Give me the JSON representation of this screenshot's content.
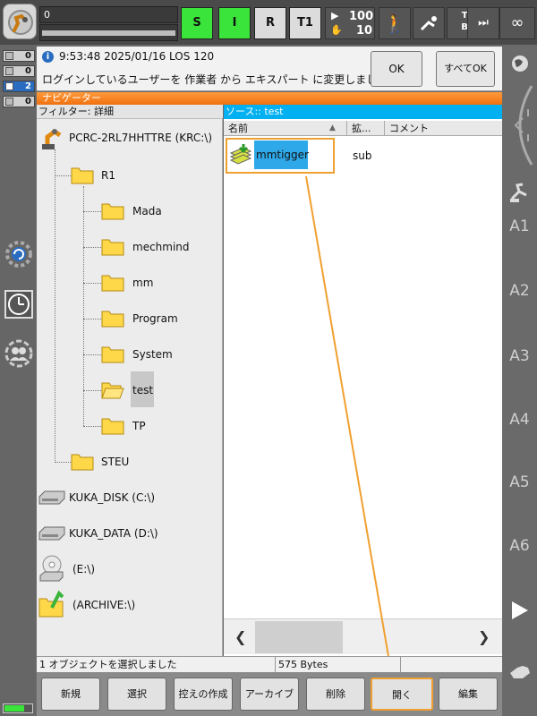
{
  "topbar": {
    "program_line": "0",
    "btn_s": "S",
    "btn_i": "I",
    "btn_r": "R",
    "mode": "T1",
    "override_prog": "100",
    "override_jog": "10",
    "tool_base_t": "T?",
    "tool_base_b": "B?",
    "incremental": "∞"
  },
  "msg_counts": [
    "0",
    "0",
    "2",
    "0"
  ],
  "message": {
    "time": "9:53:48 2025/01/16 LOS 120",
    "text": "ログインしているユーザーを 作業者 から エキスパート に変更しました。",
    "ok_label": "OK",
    "all_ok_label": "すべてOK"
  },
  "navigator": {
    "title": "ナビゲーター",
    "filter": "フィルター: 詳細",
    "source": "ソース:: test"
  },
  "tree": {
    "root": "PCRC-2RL7HHTTRE (KRC:\\)",
    "r1": "R1",
    "r1_children": [
      "Mada",
      "mechmind",
      "mm",
      "Program",
      "System",
      "test",
      "TP"
    ],
    "steu": "STEU",
    "drives": [
      "KUKA_DISK (C:\\)",
      "KUKA_DATA (D:\\)",
      "(E:\\)",
      "(ARCHIVE:\\)"
    ]
  },
  "filelist": {
    "col_name": "名前",
    "col_ext": "拡...",
    "col_comment": "コメント",
    "files": [
      {
        "name": "mmtigger",
        "type": "sub"
      }
    ]
  },
  "status": {
    "selection": "1 オブジェクトを選択しました",
    "size": "575 Bytes"
  },
  "softkeys": [
    "新規",
    "選択",
    "控えの作成",
    "アーカイブ",
    "削除",
    "開く",
    "編集"
  ],
  "right_axes": [
    "A1",
    "A2",
    "A3",
    "A4",
    "A5",
    "A6"
  ],
  "colors": {
    "accent_orange": "#f07010",
    "source_blue": "#00b0f0",
    "status_green": "#3be43b",
    "highlight_orange": "#f0a030"
  }
}
